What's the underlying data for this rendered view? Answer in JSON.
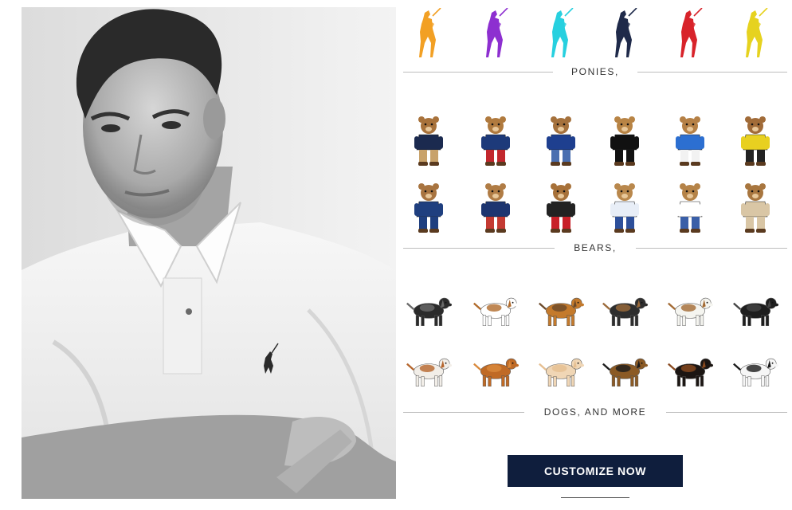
{
  "photo": {
    "alt_name": "model-in-white-polo-photo",
    "logo": "polo-pony-logo"
  },
  "ponies": {
    "label": "PONIES,",
    "items": [
      {
        "name": "orange-pony-icon",
        "color": "#f2a024"
      },
      {
        "name": "purple-pony-icon",
        "color": "#8d2fd0"
      },
      {
        "name": "turquoise-pony-icon",
        "color": "#27d0df"
      },
      {
        "name": "navy-pony-icon",
        "color": "#1f2a4a"
      },
      {
        "name": "red-pony-icon",
        "color": "#d8232a"
      },
      {
        "name": "yellow-pony-icon",
        "color": "#e6d21f"
      }
    ]
  },
  "bears": {
    "label": "BEARS,",
    "row1": [
      {
        "name": "bear-navy-blazer-icon",
        "fur": "#a8723b",
        "top": "#1b2a4f",
        "bottom": "#c8a26b"
      },
      {
        "name": "bear-red-pants-icon",
        "fur": "#b07a3e",
        "top": "#1d3a7a",
        "bottom": "#c2272d"
      },
      {
        "name": "bear-flag-sweater-icon",
        "fur": "#a5713c",
        "top": "#1e3f8f",
        "bottom": "#4a6fb0"
      },
      {
        "name": "bear-tuxedo-icon",
        "fur": "#b88445",
        "top": "#111111",
        "bottom": "#111111"
      },
      {
        "name": "bear-polo-player-icon",
        "fur": "#b58045",
        "top": "#2c6fd1",
        "bottom": "#f2f2f2"
      },
      {
        "name": "bear-yellow-ski-icon",
        "fur": "#a16b38",
        "top": "#e8d020",
        "bottom": "#222222"
      }
    ],
    "row2": [
      {
        "name": "bear-navy-coat-icon",
        "fur": "#a87440",
        "top": "#1f3f7f",
        "bottom": "#1f3f7f"
      },
      {
        "name": "bear-ski-poles-icon",
        "fur": "#b07c45",
        "top": "#1d3570",
        "bottom": "#c43a32"
      },
      {
        "name": "bear-red-skirt-icon",
        "fur": "#a77139",
        "top": "#222222",
        "bottom": "#c82028"
      },
      {
        "name": "bear-sailor-icon",
        "fur": "#b9884d",
        "top": "#e8eef7",
        "bottom": "#2d4f9a"
      },
      {
        "name": "bear-striped-dress-icon",
        "fur": "#b58348",
        "top": "#ffffff",
        "bottom": "#3a5fa8"
      },
      {
        "name": "bear-trench-coat-icon",
        "fur": "#a8763f",
        "top": "#d9c6a5",
        "bottom": "#d9c6a5"
      }
    ]
  },
  "dogs": {
    "label": "DOGS, AND MORE",
    "row1": [
      {
        "name": "french-bulldog-icon",
        "body": "#2b2b2b",
        "accent": "#6a6a6a"
      },
      {
        "name": "beagle-icon",
        "body": "#ffffff",
        "accent": "#b06a2a"
      },
      {
        "name": "yorkshire-terrier-icon",
        "body": "#c47a2c",
        "accent": "#6c4a2a"
      },
      {
        "name": "dachshund-icon",
        "body": "#2e2e2e",
        "accent": "#9b6a3a"
      },
      {
        "name": "jack-russell-icon",
        "body": "#f5f5f0",
        "accent": "#a36a33"
      },
      {
        "name": "scottish-terrier-icon",
        "body": "#1e1e1e",
        "accent": "#444444"
      }
    ],
    "row2": [
      {
        "name": "english-bulldog-icon",
        "body": "#f2eee8",
        "accent": "#b5652c"
      },
      {
        "name": "golden-retriever-icon",
        "body": "#c06a25",
        "accent": "#d9893c"
      },
      {
        "name": "poodle-icon",
        "body": "#f0d6b5",
        "accent": "#e6bf91"
      },
      {
        "name": "german-shepherd-icon",
        "body": "#8b5a25",
        "accent": "#1c1c1c"
      },
      {
        "name": "rottweiler-icon",
        "body": "#1c1613",
        "accent": "#8a4a1f"
      },
      {
        "name": "dalmatian-icon",
        "body": "#f6f6f6",
        "accent": "#1a1a1a"
      }
    ]
  },
  "cta": {
    "label": "CUSTOMIZE NOW"
  },
  "colors": {
    "cta_bg": "#0f1e3d",
    "divider": "#bdbdbd",
    "text": "#333333"
  }
}
